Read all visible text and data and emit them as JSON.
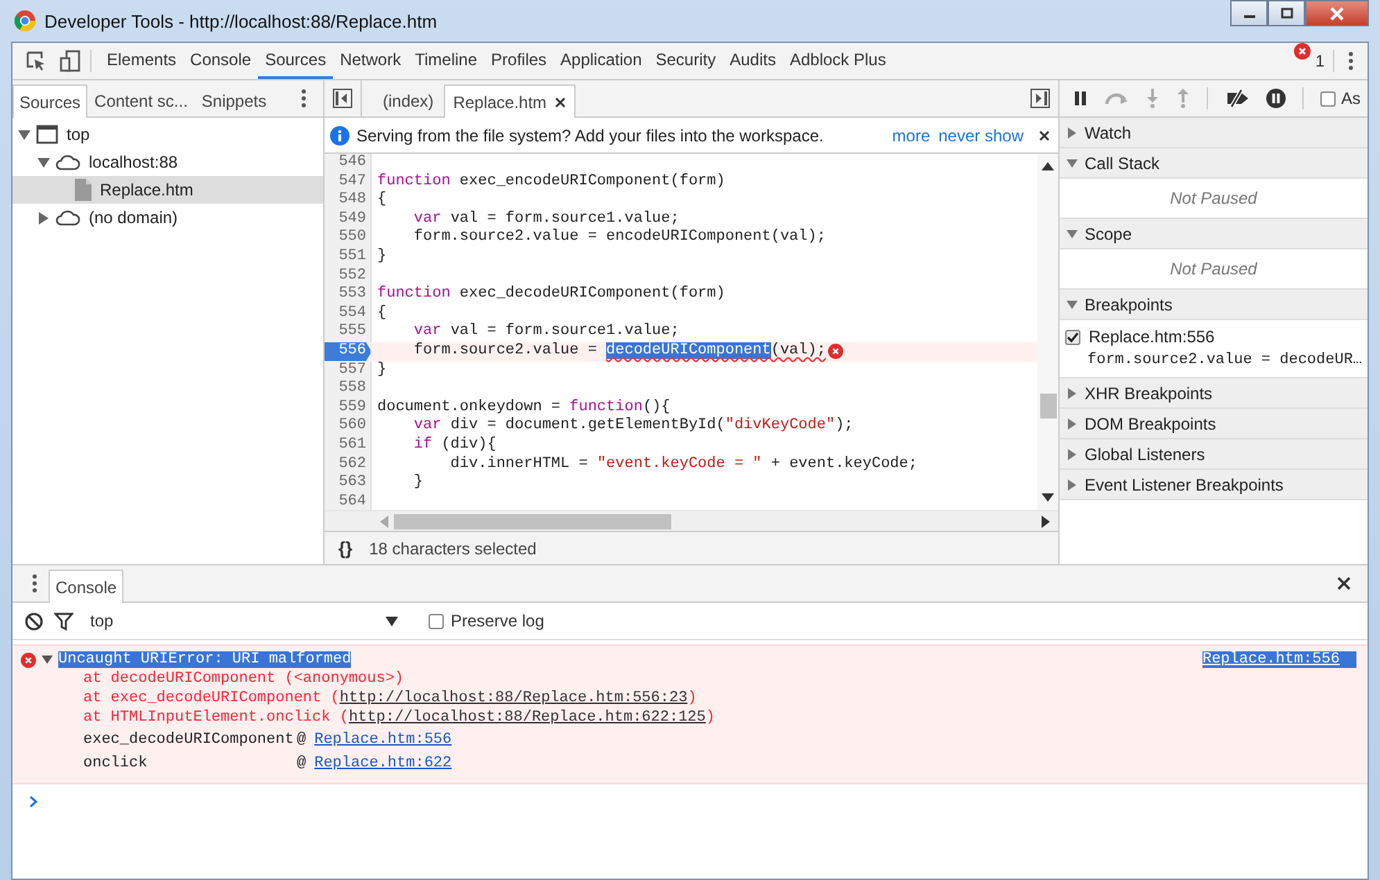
{
  "window": {
    "title": "Developer Tools - http://localhost:88/Replace.htm"
  },
  "main_tabs": [
    {
      "label": "Elements",
      "selected": false
    },
    {
      "label": "Console",
      "selected": false
    },
    {
      "label": "Sources",
      "selected": true
    },
    {
      "label": "Network",
      "selected": false
    },
    {
      "label": "Timeline",
      "selected": false
    },
    {
      "label": "Profiles",
      "selected": false
    },
    {
      "label": "Application",
      "selected": false
    },
    {
      "label": "Security",
      "selected": false
    },
    {
      "label": "Audits",
      "selected": false
    },
    {
      "label": "Adblock Plus",
      "selected": false
    }
  ],
  "error_count": "1",
  "navigator": {
    "tabs": [
      {
        "label": "Sources",
        "selected": true
      },
      {
        "label": "Content sc...",
        "selected": false
      },
      {
        "label": "Snippets",
        "selected": false
      }
    ],
    "tree": [
      {
        "label": "top",
        "kind": "frame",
        "expanded": true,
        "selected": false,
        "children": [
          {
            "label": "localhost:88",
            "kind": "domain",
            "expanded": true,
            "selected": false,
            "children": [
              {
                "label": "Replace.htm",
                "kind": "file",
                "selected": true
              }
            ]
          },
          {
            "label": "(no domain)",
            "kind": "domain",
            "expanded": false,
            "selected": false
          }
        ]
      }
    ]
  },
  "editor": {
    "tabs": [
      {
        "label": "(index)",
        "selected": false,
        "closable": false
      },
      {
        "label": "Replace.htm",
        "selected": true,
        "closable": true
      }
    ],
    "infobar": {
      "message": "Serving from the file system? Add your files into the workspace.",
      "links": [
        "more",
        "never show"
      ]
    },
    "lines": [
      {
        "number": "546"
      },
      {
        "number": "547",
        "tokens": [
          {
            "text": "function",
            "kind": "keyword"
          },
          {
            "text": " exec_encodeURIComponent(form)",
            "kind": "plain"
          }
        ]
      },
      {
        "number": "548",
        "tokens": [
          {
            "text": "{",
            "kind": "plain"
          }
        ]
      },
      {
        "number": "549",
        "tokens": [
          {
            "text": "    var",
            "kind": "keyword"
          },
          {
            "text": " val = form.source1.value;",
            "kind": "plain"
          }
        ]
      },
      {
        "number": "550",
        "tokens": [
          {
            "text": "    form.source2.value = encodeURIComponent(val);",
            "kind": "plain"
          }
        ]
      },
      {
        "number": "551",
        "tokens": [
          {
            "text": "}",
            "kind": "plain"
          }
        ]
      },
      {
        "number": "552"
      },
      {
        "number": "553",
        "tokens": [
          {
            "text": "function",
            "kind": "keyword"
          },
          {
            "text": " exec_decodeURIComponent(form)",
            "kind": "plain"
          }
        ]
      },
      {
        "number": "554",
        "tokens": [
          {
            "text": "{",
            "kind": "plain"
          }
        ]
      },
      {
        "number": "555",
        "tokens": [
          {
            "text": "    var",
            "kind": "keyword"
          },
          {
            "text": " val = form.source1.value;",
            "kind": "plain"
          }
        ]
      },
      {
        "number": "556",
        "breakpoint": true,
        "error": true,
        "tokens": [
          {
            "text": "    form.source2.value = ",
            "kind": "plain"
          },
          {
            "text": "decodeURIComponent",
            "kind": "selected",
            "squiggly": true
          },
          {
            "text": "(val);",
            "kind": "plain",
            "squiggly": true
          }
        ]
      },
      {
        "number": "557",
        "tokens": [
          {
            "text": "}",
            "kind": "plain"
          }
        ]
      },
      {
        "number": "558"
      },
      {
        "number": "559",
        "tokens": [
          {
            "text": "document.onkeydown = ",
            "kind": "plain"
          },
          {
            "text": "function",
            "kind": "keyword"
          },
          {
            "text": "(){",
            "kind": "plain"
          }
        ]
      },
      {
        "number": "560",
        "tokens": [
          {
            "text": "    var",
            "kind": "keyword"
          },
          {
            "text": " div = document.getElementById(",
            "kind": "plain"
          },
          {
            "text": "\"divKeyCode\"",
            "kind": "string"
          },
          {
            "text": ");",
            "kind": "plain"
          }
        ]
      },
      {
        "number": "561",
        "tokens": [
          {
            "text": "    if",
            "kind": "keyword"
          },
          {
            "text": " (div){",
            "kind": "plain"
          }
        ]
      },
      {
        "number": "562",
        "tokens": [
          {
            "text": "        div.innerHTML = ",
            "kind": "plain"
          },
          {
            "text": "\"event.keyCode = \"",
            "kind": "string"
          },
          {
            "text": " + event.keyCode;",
            "kind": "plain"
          }
        ]
      },
      {
        "number": "563",
        "tokens": [
          {
            "text": "    }",
            "kind": "plain"
          }
        ]
      },
      {
        "number": "564"
      }
    ],
    "pretty_print": "{}",
    "status": "18 characters selected"
  },
  "debugger": {
    "checkbox": {
      "label": "As",
      "checked": false
    },
    "sections": [
      {
        "title": "Watch",
        "expanded": false
      },
      {
        "title": "Call Stack",
        "expanded": true,
        "message": "Not Paused"
      },
      {
        "title": "Scope",
        "expanded": true,
        "message": "Not Paused"
      },
      {
        "title": "Breakpoints",
        "expanded": true,
        "breakpoints": [
          {
            "location": "Replace.htm:556",
            "code": "form.source2.value = decodeUR…",
            "checked": true
          }
        ]
      },
      {
        "title": "XHR Breakpoints",
        "expanded": false
      },
      {
        "title": "DOM Breakpoints",
        "expanded": false
      },
      {
        "title": "Global Listeners",
        "expanded": false
      },
      {
        "title": "Event Listener Breakpoints",
        "expanded": false
      }
    ]
  },
  "console": {
    "tab": {
      "label": "Console",
      "selected": true
    },
    "context": "top",
    "preserve_log": {
      "label": "Preserve log",
      "checked": false
    },
    "error": {
      "message": "Uncaught URIError: URI malformed",
      "highlighted": true,
      "expanded": true,
      "source": {
        "text": "Replace.htm:556",
        "highlighted": true
      },
      "stack": [
        {
          "text": "at decodeURIComponent (<anonymous>)"
        },
        {
          "text": "at exec_decodeURIComponent (",
          "url": "http://localhost:88/Replace.htm:556:23",
          "after": ")"
        },
        {
          "text": "at HTMLInputElement.onclick (",
          "url": "http://localhost:88/Replace.htm:622:125",
          "after": ")"
        }
      ],
      "frames": [
        {
          "function": "exec_decodeURIComponent",
          "separator": "@",
          "link": "Replace.htm:556"
        },
        {
          "function": "onclick",
          "separator": "@",
          "link": "Replace.htm:622"
        }
      ]
    }
  }
}
